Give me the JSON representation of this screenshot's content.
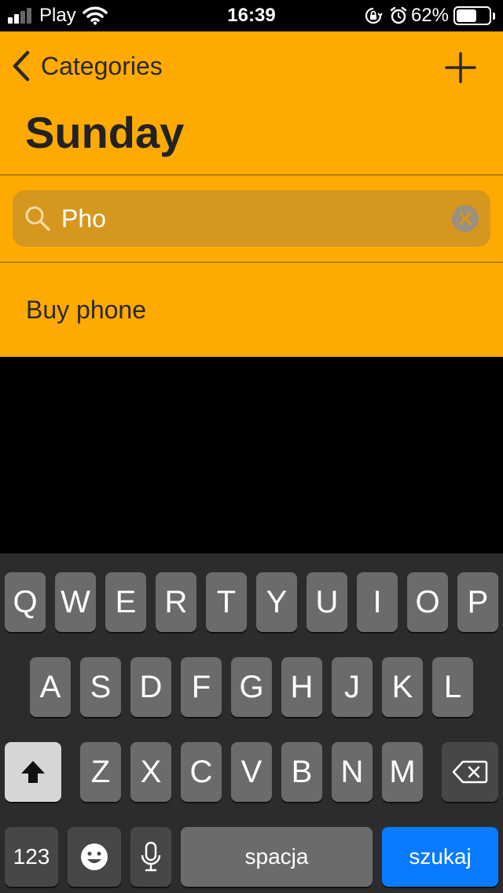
{
  "status_bar": {
    "carrier": "Play",
    "time": "16:39",
    "battery_percent": "62%",
    "battery_level": 0.62,
    "signal_bars": 4,
    "signal_bars_active": 2
  },
  "nav": {
    "back_label": "Categories",
    "title": "Sunday"
  },
  "search": {
    "value": "Pho"
  },
  "results": [
    {
      "label": "Buy phone"
    }
  ],
  "keyboard": {
    "row1": [
      "Q",
      "W",
      "E",
      "R",
      "T",
      "Y",
      "U",
      "I",
      "O",
      "P"
    ],
    "row2": [
      "A",
      "S",
      "D",
      "F",
      "G",
      "H",
      "J",
      "K",
      "L"
    ],
    "row3": [
      "Z",
      "X",
      "C",
      "V",
      "B",
      "N",
      "M"
    ],
    "numbers_label": "123",
    "space_label": "spacja",
    "return_label": "szukaj"
  },
  "colors": {
    "accent": "#FFAA00",
    "search_field": "#D6971F",
    "keyboard_bg": "#2c2c2e",
    "key": "#6b6b6b",
    "return_key": "#0a7aff"
  }
}
